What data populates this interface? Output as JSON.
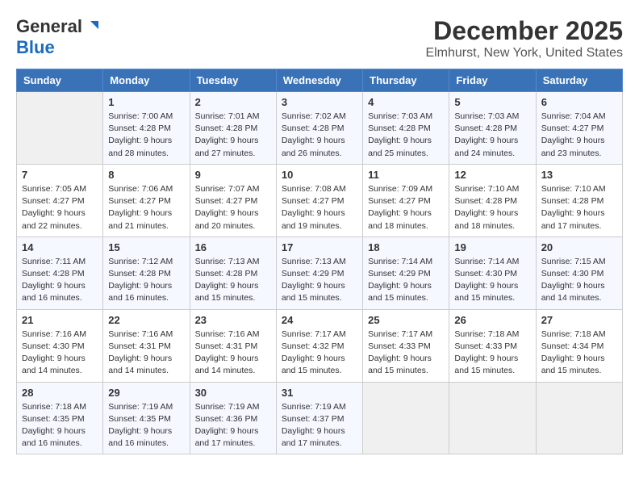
{
  "logo": {
    "line1": "General",
    "line2": "Blue"
  },
  "title": "December 2025",
  "subtitle": "Elmhurst, New York, United States",
  "weekdays": [
    "Sunday",
    "Monday",
    "Tuesday",
    "Wednesday",
    "Thursday",
    "Friday",
    "Saturday"
  ],
  "weeks": [
    [
      {
        "day": "",
        "info": ""
      },
      {
        "day": "1",
        "info": "Sunrise: 7:00 AM\nSunset: 4:28 PM\nDaylight: 9 hours\nand 28 minutes."
      },
      {
        "day": "2",
        "info": "Sunrise: 7:01 AM\nSunset: 4:28 PM\nDaylight: 9 hours\nand 27 minutes."
      },
      {
        "day": "3",
        "info": "Sunrise: 7:02 AM\nSunset: 4:28 PM\nDaylight: 9 hours\nand 26 minutes."
      },
      {
        "day": "4",
        "info": "Sunrise: 7:03 AM\nSunset: 4:28 PM\nDaylight: 9 hours\nand 25 minutes."
      },
      {
        "day": "5",
        "info": "Sunrise: 7:03 AM\nSunset: 4:28 PM\nDaylight: 9 hours\nand 24 minutes."
      },
      {
        "day": "6",
        "info": "Sunrise: 7:04 AM\nSunset: 4:27 PM\nDaylight: 9 hours\nand 23 minutes."
      }
    ],
    [
      {
        "day": "7",
        "info": "Sunrise: 7:05 AM\nSunset: 4:27 PM\nDaylight: 9 hours\nand 22 minutes."
      },
      {
        "day": "8",
        "info": "Sunrise: 7:06 AM\nSunset: 4:27 PM\nDaylight: 9 hours\nand 21 minutes."
      },
      {
        "day": "9",
        "info": "Sunrise: 7:07 AM\nSunset: 4:27 PM\nDaylight: 9 hours\nand 20 minutes."
      },
      {
        "day": "10",
        "info": "Sunrise: 7:08 AM\nSunset: 4:27 PM\nDaylight: 9 hours\nand 19 minutes."
      },
      {
        "day": "11",
        "info": "Sunrise: 7:09 AM\nSunset: 4:27 PM\nDaylight: 9 hours\nand 18 minutes."
      },
      {
        "day": "12",
        "info": "Sunrise: 7:10 AM\nSunset: 4:28 PM\nDaylight: 9 hours\nand 18 minutes."
      },
      {
        "day": "13",
        "info": "Sunrise: 7:10 AM\nSunset: 4:28 PM\nDaylight: 9 hours\nand 17 minutes."
      }
    ],
    [
      {
        "day": "14",
        "info": "Sunrise: 7:11 AM\nSunset: 4:28 PM\nDaylight: 9 hours\nand 16 minutes."
      },
      {
        "day": "15",
        "info": "Sunrise: 7:12 AM\nSunset: 4:28 PM\nDaylight: 9 hours\nand 16 minutes."
      },
      {
        "day": "16",
        "info": "Sunrise: 7:13 AM\nSunset: 4:28 PM\nDaylight: 9 hours\nand 15 minutes."
      },
      {
        "day": "17",
        "info": "Sunrise: 7:13 AM\nSunset: 4:29 PM\nDaylight: 9 hours\nand 15 minutes."
      },
      {
        "day": "18",
        "info": "Sunrise: 7:14 AM\nSunset: 4:29 PM\nDaylight: 9 hours\nand 15 minutes."
      },
      {
        "day": "19",
        "info": "Sunrise: 7:14 AM\nSunset: 4:30 PM\nDaylight: 9 hours\nand 15 minutes."
      },
      {
        "day": "20",
        "info": "Sunrise: 7:15 AM\nSunset: 4:30 PM\nDaylight: 9 hours\nand 14 minutes."
      }
    ],
    [
      {
        "day": "21",
        "info": "Sunrise: 7:16 AM\nSunset: 4:30 PM\nDaylight: 9 hours\nand 14 minutes."
      },
      {
        "day": "22",
        "info": "Sunrise: 7:16 AM\nSunset: 4:31 PM\nDaylight: 9 hours\nand 14 minutes."
      },
      {
        "day": "23",
        "info": "Sunrise: 7:16 AM\nSunset: 4:31 PM\nDaylight: 9 hours\nand 14 minutes."
      },
      {
        "day": "24",
        "info": "Sunrise: 7:17 AM\nSunset: 4:32 PM\nDaylight: 9 hours\nand 15 minutes."
      },
      {
        "day": "25",
        "info": "Sunrise: 7:17 AM\nSunset: 4:33 PM\nDaylight: 9 hours\nand 15 minutes."
      },
      {
        "day": "26",
        "info": "Sunrise: 7:18 AM\nSunset: 4:33 PM\nDaylight: 9 hours\nand 15 minutes."
      },
      {
        "day": "27",
        "info": "Sunrise: 7:18 AM\nSunset: 4:34 PM\nDaylight: 9 hours\nand 15 minutes."
      }
    ],
    [
      {
        "day": "28",
        "info": "Sunrise: 7:18 AM\nSunset: 4:35 PM\nDaylight: 9 hours\nand 16 minutes."
      },
      {
        "day": "29",
        "info": "Sunrise: 7:19 AM\nSunset: 4:35 PM\nDaylight: 9 hours\nand 16 minutes."
      },
      {
        "day": "30",
        "info": "Sunrise: 7:19 AM\nSunset: 4:36 PM\nDaylight: 9 hours\nand 17 minutes."
      },
      {
        "day": "31",
        "info": "Sunrise: 7:19 AM\nSunset: 4:37 PM\nDaylight: 9 hours\nand 17 minutes."
      },
      {
        "day": "",
        "info": ""
      },
      {
        "day": "",
        "info": ""
      },
      {
        "day": "",
        "info": ""
      }
    ]
  ]
}
